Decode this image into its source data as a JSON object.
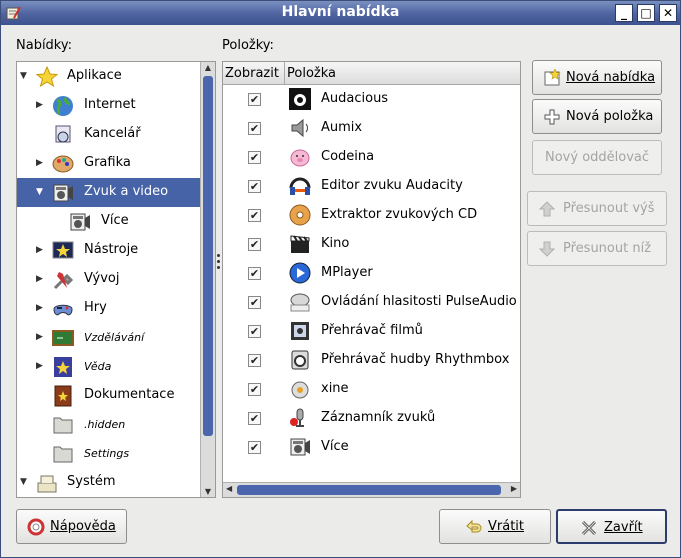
{
  "window": {
    "title": "Hlavní nabídka",
    "minimize": "_",
    "maximize": "□",
    "close": "✕"
  },
  "labels": {
    "menus": "Nabídky:",
    "items": "Položky:"
  },
  "tree": [
    {
      "label": "Aplikace",
      "expander": "▼",
      "icon": "star-icon",
      "level": 0,
      "selected": false,
      "small": false
    },
    {
      "label": "Internet",
      "expander": "▶",
      "icon": "globe-icon",
      "level": 1,
      "selected": false,
      "small": false
    },
    {
      "label": "Kancelář",
      "expander": "",
      "icon": "office-icon",
      "level": 1,
      "selected": false,
      "small": false
    },
    {
      "label": "Grafika",
      "expander": "▶",
      "icon": "palette-icon",
      "level": 1,
      "selected": false,
      "small": false
    },
    {
      "label": "Zvuk a video",
      "expander": "▼",
      "icon": "multimedia-icon",
      "level": 1,
      "selected": true,
      "small": false
    },
    {
      "label": "Více",
      "expander": "",
      "icon": "multimedia-icon",
      "level": 2,
      "selected": false,
      "small": false
    },
    {
      "label": "Nástroje",
      "expander": "▶",
      "icon": "tools-icon",
      "level": 1,
      "selected": false,
      "small": false
    },
    {
      "label": "Vývoj",
      "expander": "▶",
      "icon": "development-icon",
      "level": 1,
      "selected": false,
      "small": false
    },
    {
      "label": "Hry",
      "expander": "▶",
      "icon": "gamepad-icon",
      "level": 1,
      "selected": false,
      "small": false
    },
    {
      "label": "Vzdělávání",
      "expander": "▶",
      "icon": "education-icon",
      "level": 1,
      "selected": false,
      "small": true
    },
    {
      "label": "Věda",
      "expander": "▶",
      "icon": "science-icon",
      "level": 1,
      "selected": false,
      "small": true
    },
    {
      "label": "Dokumentace",
      "expander": "",
      "icon": "documentation-icon",
      "level": 1,
      "selected": false,
      "small": false
    },
    {
      "label": ".hidden",
      "expander": "",
      "icon": "folder-icon",
      "level": 1,
      "selected": false,
      "small": true
    },
    {
      "label": "Settings",
      "expander": "",
      "icon": "folder-icon",
      "level": 1,
      "selected": false,
      "small": true
    },
    {
      "label": "Systém",
      "expander": "▼",
      "icon": "system-icon",
      "level": 0,
      "selected": false,
      "small": false
    }
  ],
  "list": {
    "columns": [
      "Zobrazit",
      "Položka"
    ],
    "checkmark": "✔",
    "rows": [
      {
        "label": "Audacious",
        "checked": true,
        "icon": "audacious-icon"
      },
      {
        "label": "Aumix",
        "checked": true,
        "icon": "speaker-icon"
      },
      {
        "label": "Codeina",
        "checked": true,
        "icon": "codeina-pig-icon"
      },
      {
        "label": "Editor zvuku Audacity",
        "checked": true,
        "icon": "audacity-icon"
      },
      {
        "label": "Extraktor zvukových CD",
        "checked": true,
        "icon": "cd-extractor-icon"
      },
      {
        "label": "Kino",
        "checked": true,
        "icon": "clapperboard-icon"
      },
      {
        "label": "MPlayer",
        "checked": true,
        "icon": "mplayer-icon"
      },
      {
        "label": "Ovládání hlasitosti PulseAudio",
        "checked": true,
        "icon": "pulseaudio-icon"
      },
      {
        "label": "Přehrávač filmů",
        "checked": true,
        "icon": "movie-player-icon"
      },
      {
        "label": "Přehrávač hudby Rhythmbox",
        "checked": true,
        "icon": "rhythmbox-icon"
      },
      {
        "label": "xine",
        "checked": true,
        "icon": "xine-icon"
      },
      {
        "label": "Záznamník zvuků",
        "checked": true,
        "icon": "sound-recorder-icon"
      },
      {
        "label": "Více",
        "checked": true,
        "icon": "multimedia-icon"
      }
    ]
  },
  "buttons": {
    "new_menu": {
      "label": "Nová nabídka",
      "enabled": true
    },
    "new_item": {
      "label": "Nová položka",
      "enabled": true
    },
    "new_separator": {
      "label": "Nový oddělovač",
      "enabled": false
    },
    "move_up": {
      "label": "Přesunout výš",
      "enabled": false
    },
    "move_down": {
      "label": "Přesunout níž",
      "enabled": false
    },
    "help": {
      "label": "Nápověda",
      "enabled": true
    },
    "revert": {
      "label": "Vrátit",
      "enabled": true
    },
    "close": {
      "label": "Zavřít",
      "enabled": true
    }
  },
  "colors": {
    "selection": "#4763a8",
    "titlebar": "#4e63a0"
  }
}
